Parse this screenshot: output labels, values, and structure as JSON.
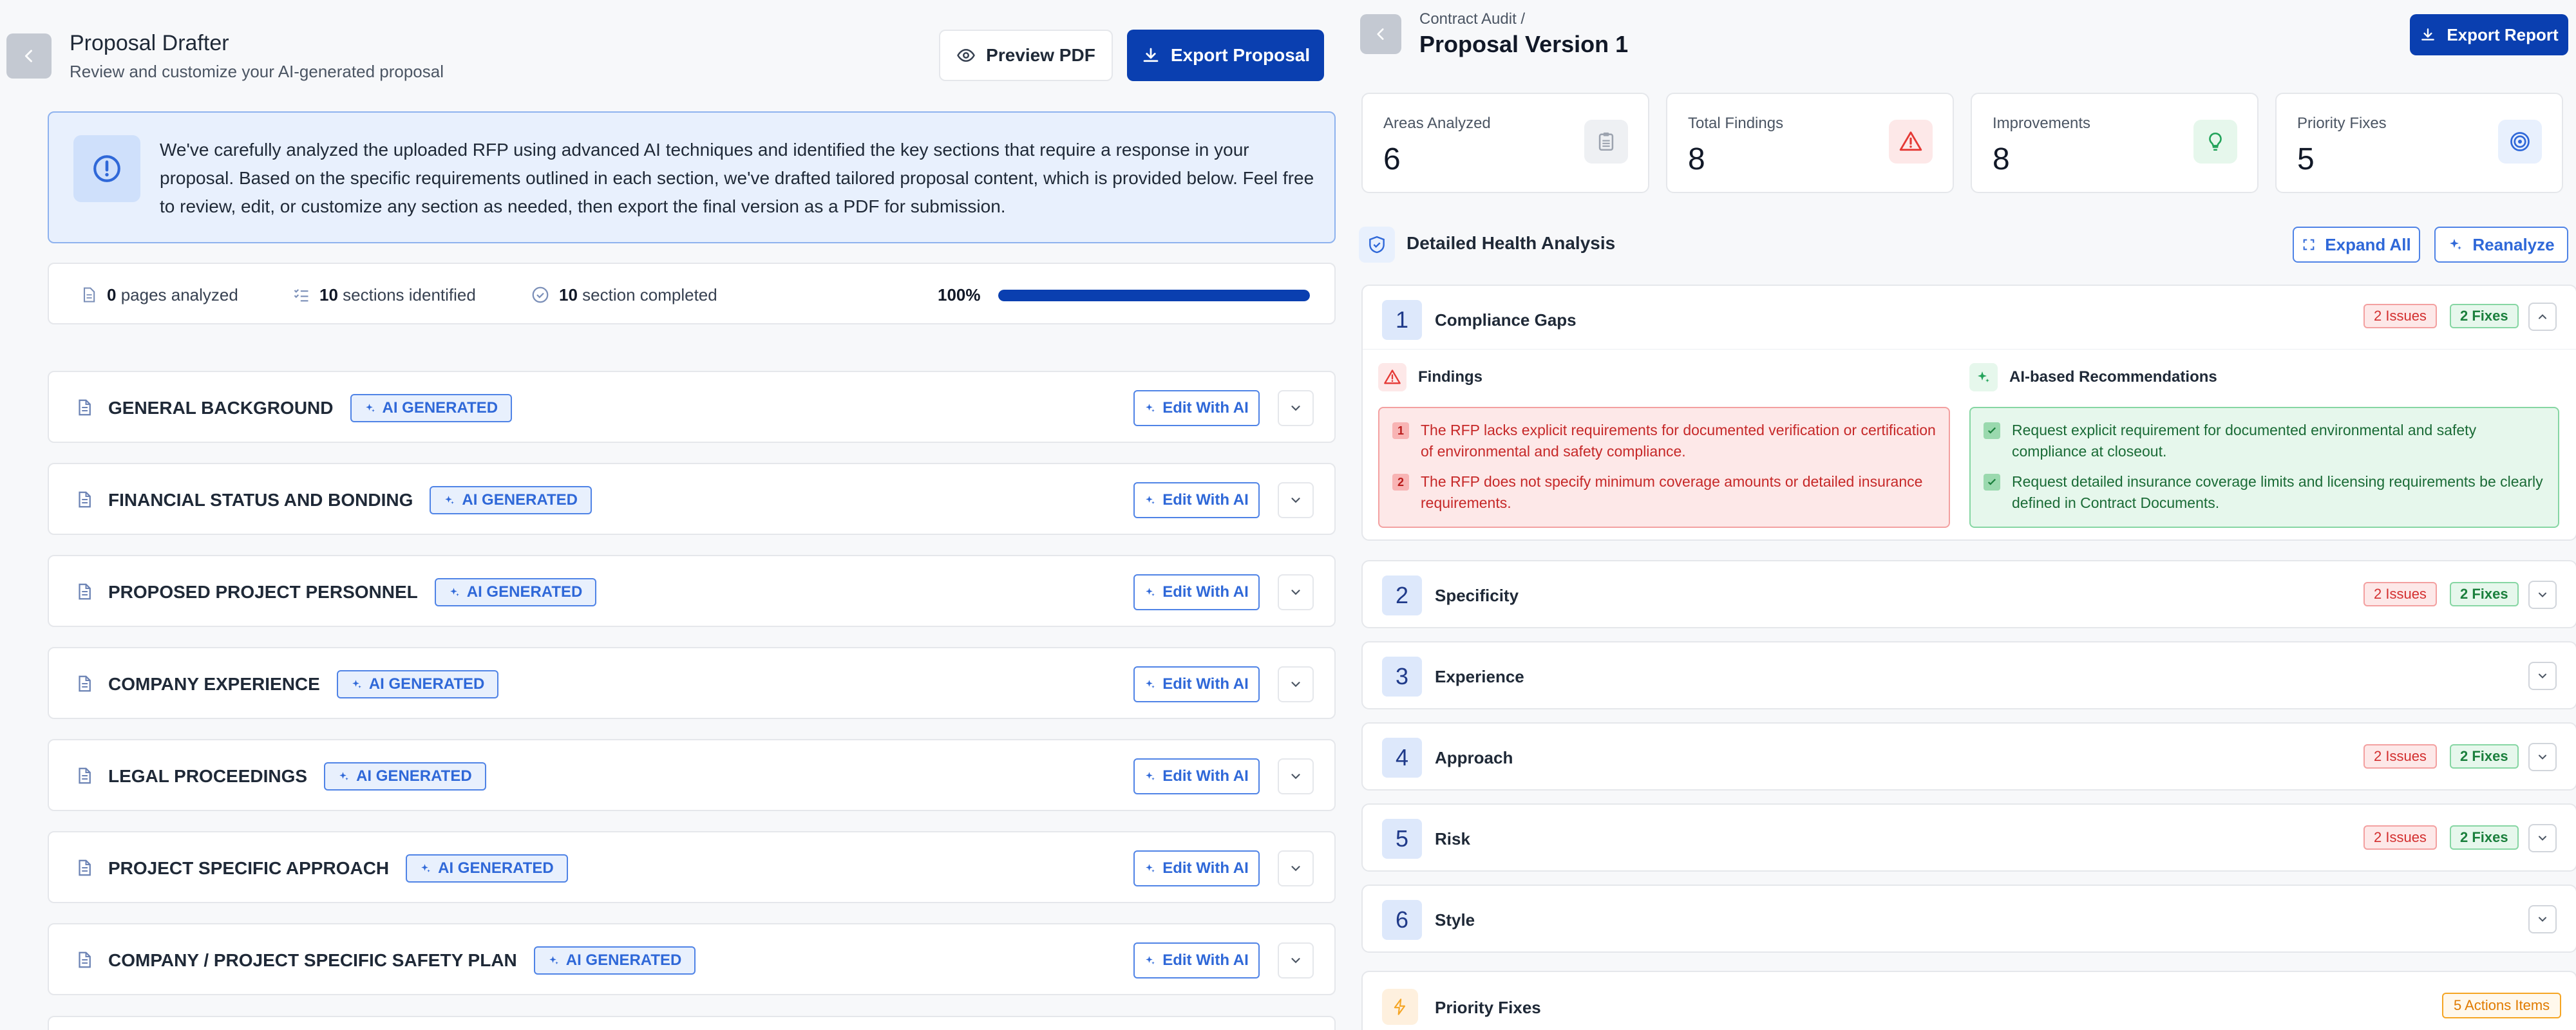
{
  "left": {
    "title": "Proposal Drafter",
    "subtitle": "Review and customize your AI-generated proposal",
    "preview_label": "Preview PDF",
    "export_label": "Export Proposal",
    "info_text": "We've carefully analyzed the uploaded RFP using advanced AI techniques and identified the key sections that require a response in your proposal. Based on the specific requirements outlined in each section, we've drafted tailored proposal content, which is provided below. Feel free to review, edit, or customize any section as needed, then export the final version as a PDF for submission.",
    "stats": {
      "pages_count": "0",
      "pages_label": "pages analyzed",
      "sections_count": "10",
      "sections_label": "sections identified",
      "completed_count": "10",
      "completed_label": "section completed",
      "progress_text": "100%",
      "progress": 1.0
    },
    "badge_label": "AI GENERATED",
    "edit_label": "Edit With AI",
    "sections": [
      {
        "title": "GENERAL BACKGROUND"
      },
      {
        "title": "FINANCIAL STATUS AND BONDING"
      },
      {
        "title": "PROPOSED PROJECT PERSONNEL"
      },
      {
        "title": "COMPANY EXPERIENCE"
      },
      {
        "title": "LEGAL PROCEEDINGS"
      },
      {
        "title": "PROJECT SPECIFIC APPROACH"
      },
      {
        "title": "COMPANY / PROJECT SPECIFIC SAFETY PLAN"
      }
    ]
  },
  "right": {
    "breadcrumb": "Contract Audit /",
    "title": "Proposal Version 1",
    "export_label": "Export Report",
    "cards": [
      {
        "label": "Areas Analyzed",
        "value": "6",
        "icon": "clipboard-icon"
      },
      {
        "label": "Total Findings",
        "value": "8",
        "icon": "warning-icon"
      },
      {
        "label": "Improvements",
        "value": "8",
        "icon": "lightbulb-icon"
      },
      {
        "label": "Priority Fixes",
        "value": "5",
        "icon": "target-icon"
      }
    ],
    "analysis_title": "Detailed Health Analysis",
    "expand_label": "Expand All",
    "reanalyze_label": "Reanalyze",
    "findings_label": "Findings",
    "recs_label": "AI-based Recommendations",
    "areas": [
      {
        "num": "1",
        "name": "Compliance Gaps",
        "issues": "2 Issues",
        "fixes": "2 Fixes"
      },
      {
        "num": "2",
        "name": "Specificity",
        "issues": "2 Issues",
        "fixes": "2 Fixes"
      },
      {
        "num": "3",
        "name": "Experience",
        "issues": "",
        "fixes": ""
      },
      {
        "num": "4",
        "name": "Approach",
        "issues": "2 Issues",
        "fixes": "2 Fixes"
      },
      {
        "num": "5",
        "name": "Risk",
        "issues": "2 Issues",
        "fixes": "2 Fixes"
      },
      {
        "num": "6",
        "name": "Style",
        "issues": "",
        "fixes": ""
      }
    ],
    "findings": [
      {
        "num": "1",
        "text": "The RFP lacks explicit requirements for documented verification or certification of environmental and safety compliance."
      },
      {
        "num": "2",
        "text": "The RFP does not specify minimum coverage amounts or detailed insurance requirements."
      }
    ],
    "recommendations": [
      {
        "text": "Request explicit requirement for documented environmental and safety compliance at closeout."
      },
      {
        "text": "Request detailed insurance coverage limits and licensing requirements be clearly defined in Contract Documents."
      }
    ],
    "priority": {
      "title": "Priority Fixes",
      "badge": "5 Actions Items"
    }
  }
}
